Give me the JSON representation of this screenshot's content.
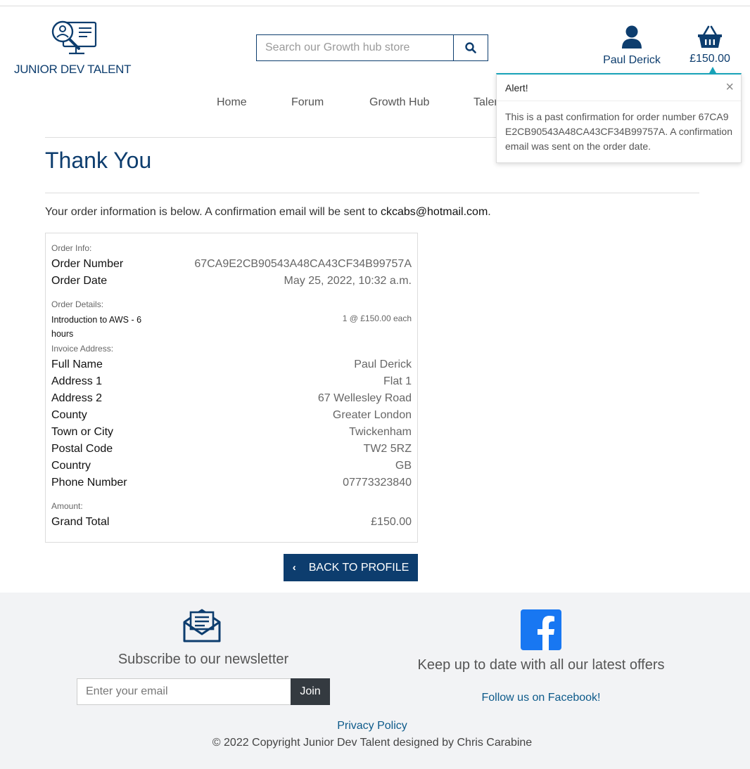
{
  "header": {
    "brand": "JUNIOR DEV TALENT",
    "search_placeholder": "Search our Growth hub store",
    "account_name": "Paul Derick",
    "basket_total": "£150.00"
  },
  "nav": {
    "items": [
      "Home",
      "Forum",
      "Growth Hub",
      "Talent"
    ]
  },
  "alert": {
    "title": "Alert!",
    "message": "This is a past confirmation for order number 67CA9E2CB90543A48CA43CF34B99757A. A confirmation email was sent on the order date.",
    "close_symbol": "×"
  },
  "page": {
    "title": "Thank You",
    "intro_text": "Your order information is below. A confirmation email will be sent to ",
    "intro_email": "ckcabs@hotmail.com",
    "intro_end": "."
  },
  "order": {
    "order_info_label": "Order Info:",
    "order_number_label": "Order Number",
    "order_number": "67CA9E2CB90543A48CA43CF34B99757A",
    "order_date_label": "Order Date",
    "order_date": "May 25, 2022, 10:32 a.m.",
    "order_details_label": "Order Details:",
    "item_name": "Introduction to AWS - 6 hours",
    "item_qty": "1 @ £150.00 each",
    "invoice_label": "Invoice Address:",
    "invoice": [
      {
        "label": "Full Name",
        "value": "Paul Derick"
      },
      {
        "label": "Address 1",
        "value": "Flat 1"
      },
      {
        "label": "Address 2",
        "value": "67 Wellesley Road"
      },
      {
        "label": "County",
        "value": "Greater London"
      },
      {
        "label": "Town or City",
        "value": "Twickenham"
      },
      {
        "label": "Postal Code",
        "value": "TW2 5RZ"
      },
      {
        "label": "Country",
        "value": "GB"
      },
      {
        "label": "Phone Number",
        "value": "07773323840"
      }
    ],
    "amount_label": "Amount:",
    "grand_total_label": "Grand Total",
    "grand_total": "£150.00"
  },
  "back_button": {
    "label": "BACK TO PROFILE"
  },
  "footer": {
    "newsletter_title": "Subscribe to our newsletter",
    "email_placeholder": "Enter your email",
    "join_label": "Join",
    "facebook_title": "Keep up to date with all our latest offers",
    "facebook_link": "Follow us on Facebook!",
    "privacy": "Privacy Policy",
    "copyright": "© 2022 Copyright Junior Dev Talent designed by Chris Carabine"
  },
  "colors": {
    "brand_navy": "#0d3d6e",
    "alert_accent": "#17a2b8",
    "facebook_blue": "#1877f2",
    "footer_bg": "#f2f3f5",
    "join_button": "#343a40"
  },
  "icons": [
    "logo-icon",
    "search-icon",
    "user-icon",
    "basket-icon",
    "close-icon",
    "chevron-left-icon",
    "envelope-icon",
    "facebook-icon"
  ]
}
